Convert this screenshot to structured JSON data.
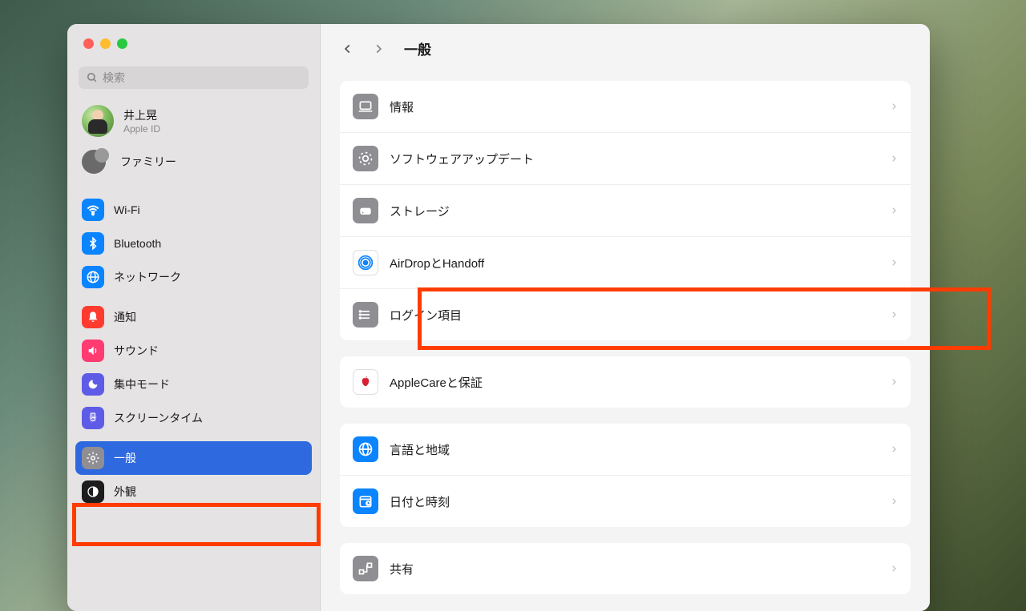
{
  "search": {
    "placeholder": "検索"
  },
  "account": {
    "name": "井上晃",
    "sub": "Apple ID"
  },
  "family": {
    "label": "ファミリー"
  },
  "sidebar": {
    "items": [
      {
        "label": "Wi-Fi",
        "icon": "wifi"
      },
      {
        "label": "Bluetooth",
        "icon": "bluetooth"
      },
      {
        "label": "ネットワーク",
        "icon": "network"
      },
      {
        "label": "通知",
        "icon": "bell"
      },
      {
        "label": "サウンド",
        "icon": "sound"
      },
      {
        "label": "集中モード",
        "icon": "focus"
      },
      {
        "label": "スクリーンタイム",
        "icon": "screentime"
      },
      {
        "label": "一般",
        "icon": "gear",
        "selected": true,
        "highlighted": true
      },
      {
        "label": "外観",
        "icon": "appearance"
      }
    ]
  },
  "main": {
    "title": "一般",
    "groups": [
      [
        {
          "label": "情報",
          "icon": "info"
        },
        {
          "label": "ソフトウェアアップデート",
          "icon": "update"
        },
        {
          "label": "ストレージ",
          "icon": "storage"
        },
        {
          "label": "AirDropとHandoff",
          "icon": "airdrop"
        },
        {
          "label": "ログイン項目",
          "icon": "login",
          "highlighted": true
        }
      ],
      [
        {
          "label": "AppleCareと保証",
          "icon": "applecare"
        }
      ],
      [
        {
          "label": "言語と地域",
          "icon": "language"
        },
        {
          "label": "日付と時刻",
          "icon": "datetime"
        }
      ],
      [
        {
          "label": "共有",
          "icon": "share"
        }
      ]
    ]
  }
}
